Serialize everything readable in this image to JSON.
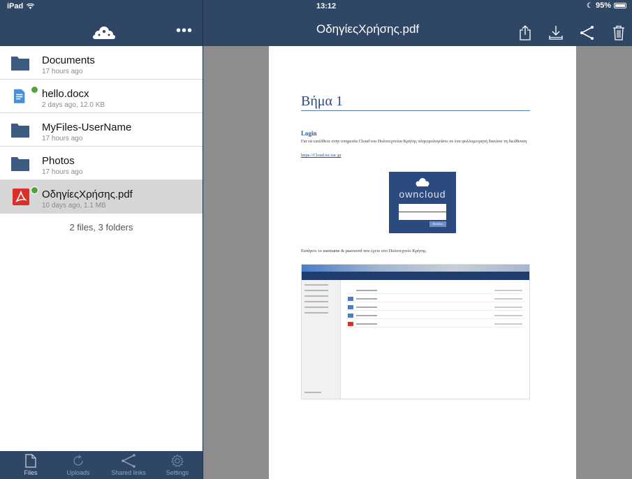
{
  "status_bar": {
    "device": "iPad",
    "time": "13:12",
    "battery": "95%"
  },
  "left_pane": {
    "more_label": "•••",
    "files": [
      {
        "name": "Documents",
        "meta": "17 hours ago",
        "type": "folder",
        "synced": false,
        "selected": false
      },
      {
        "name": "hello.docx",
        "meta": "2 days ago, 12.0 KB",
        "type": "docx",
        "synced": true,
        "selected": false
      },
      {
        "name": "MyFiles-UserName",
        "meta": "17 hours ago",
        "type": "folder",
        "synced": false,
        "selected": false
      },
      {
        "name": "Photos",
        "meta": "17 hours ago",
        "type": "folder",
        "synced": false,
        "selected": false
      },
      {
        "name": "ΟδηγίεςΧρήσης.pdf",
        "meta": "10 days ago, 1.1 MB",
        "type": "pdf",
        "synced": true,
        "selected": true
      }
    ],
    "summary": "2 files, 3 folders",
    "tabs": [
      {
        "label": "Files",
        "icon": "file-icon",
        "active": true
      },
      {
        "label": "Uploads",
        "icon": "refresh-icon",
        "active": false
      },
      {
        "label": "Shared links",
        "icon": "share-icon",
        "active": false
      },
      {
        "label": "Settings",
        "icon": "gear-icon",
        "active": false
      }
    ]
  },
  "right_pane": {
    "title": "ΟδηγίεςΧρήσης.pdf",
    "actions": [
      "open-in-icon",
      "download-icon",
      "share-icon",
      "trash-icon"
    ],
    "pdf": {
      "heading": "Βήμα 1",
      "login_heading": "Login",
      "paragraph": "Για να εισέλθετε στην υπηρεσία Cloud του Πολυτεχνείου Κρήτης πληκτρολογείστε σε ένα φυλλομετρητή δικτύου τη διεύθυνση",
      "link": "https://Cloud.isc.tuc.gr",
      "owncloud_word": "owncloud",
      "owncloud_button": "Είσοδος",
      "paragraph2": "Εισάγετε το username & password που έχετε στο Πολυτεχνείο Κρήτης."
    }
  },
  "colors": {
    "header": "#2f4765",
    "selected_row": "#d6d6d6",
    "folder": "#3d5a80",
    "sync_ok": "#4fa43a",
    "viewer_bg": "#8d8d8d"
  }
}
